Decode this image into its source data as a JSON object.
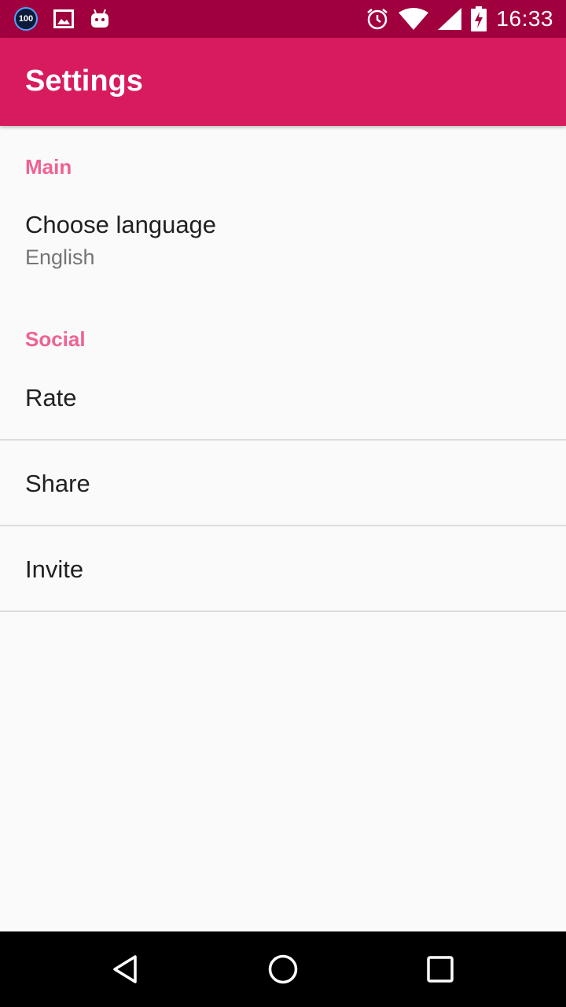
{
  "status_bar": {
    "badge": "100",
    "time": "16:33",
    "icons": [
      "notification-100-icon",
      "image-icon",
      "android-icon",
      "alarm-icon",
      "wifi-icon",
      "signal-icon",
      "battery-charging-icon"
    ]
  },
  "app_bar": {
    "title": "Settings",
    "color": "#d81b5e"
  },
  "sections": {
    "main": {
      "header": "Main",
      "choose_language": {
        "title": "Choose language",
        "summary": "English"
      }
    },
    "social": {
      "header": "Social",
      "rate": "Rate",
      "share": "Share",
      "invite": "Invite"
    }
  },
  "colors": {
    "status_bar": "#a0003e",
    "accent": "#f06292"
  },
  "nav_bar": {
    "icons": [
      "back-icon",
      "home-icon",
      "recents-icon"
    ]
  }
}
